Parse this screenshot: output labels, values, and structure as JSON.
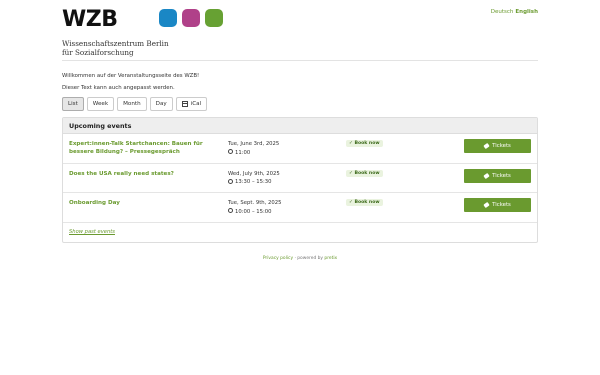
{
  "header": {
    "logo": "WZB",
    "subtitle_line1": "Wissenschaftszentrum Berlin",
    "subtitle_line2": "für Sozialforschung",
    "dot_colors": [
      "#1a87c5",
      "#b04189",
      "#67a133"
    ]
  },
  "language": {
    "de": "Deutsch",
    "en": "English"
  },
  "intro": {
    "line1": "Willkommen auf der Veranstaltungsseite des WZB!",
    "line2": "Dieser Text kann auch angepasst werden."
  },
  "views": {
    "list": "List",
    "week": "Week",
    "month": "Month",
    "day": "Day",
    "ical": "iCal"
  },
  "events": {
    "heading": "Upcoming events",
    "items": [
      {
        "title": "Expert:innen-Talk Startchancen: Bauen für bessere Bildung? – Pressegespräch",
        "date": "Tue, June 3rd, 2025",
        "time": "11:00",
        "status": "Book now",
        "button": "Tickets"
      },
      {
        "title": "Does the USA really need states?",
        "date": "Wed, July 9th, 2025",
        "time": "13:30 – 15:30",
        "status": "Book now",
        "button": "Tickets"
      },
      {
        "title": "Onboarding Day",
        "date": "Tue, Sept. 9th, 2025",
        "time": "10:00 – 15:00",
        "status": "Book now",
        "button": "Tickets"
      }
    ],
    "past_link": "Show past events"
  },
  "footer": {
    "privacy": "Privacy policy",
    "separator": "·",
    "powered": "powered by",
    "brand": "pretix"
  },
  "colors": {
    "accent": "#6a9a2f"
  }
}
